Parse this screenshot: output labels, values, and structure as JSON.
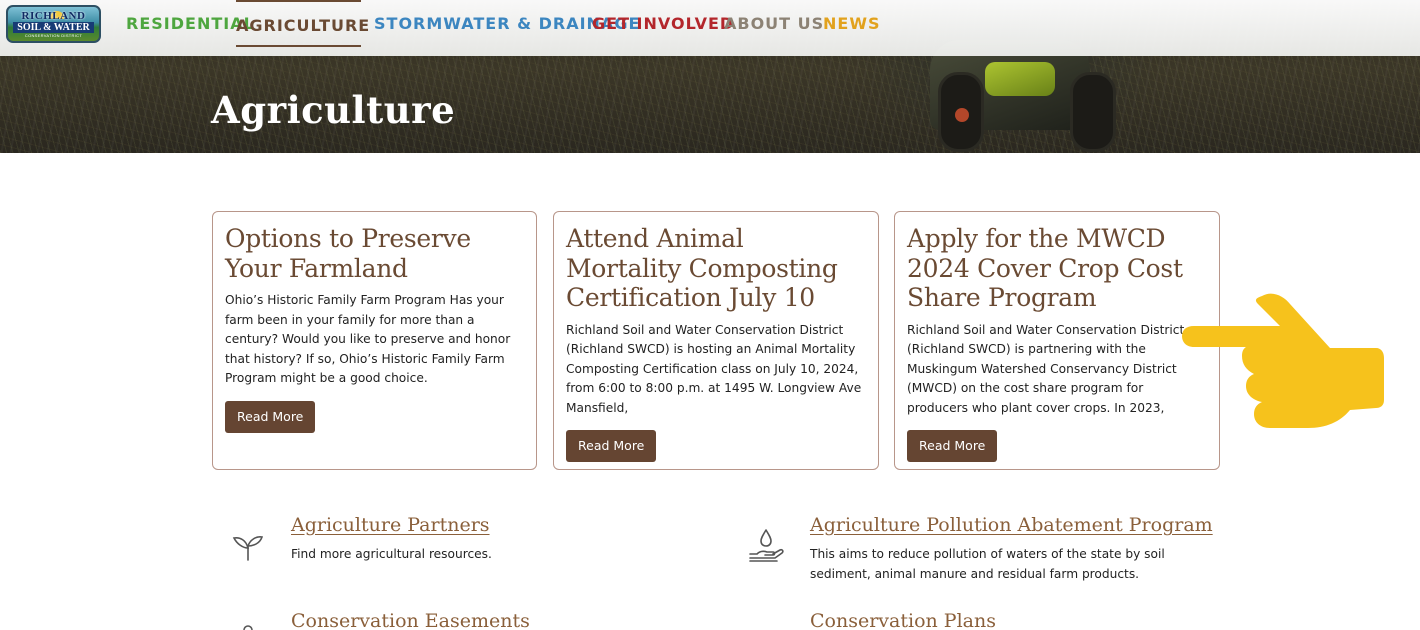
{
  "logo": {
    "line1": "RICHLAND",
    "line2": "SOIL & WATER",
    "line3": "CONSERVATION DISTRICT"
  },
  "nav": {
    "items": [
      {
        "label": "RESIDENTIAL",
        "color": "#4ea63f"
      },
      {
        "label": "AGRICULTURE",
        "color": "#6a4a33",
        "active": true
      },
      {
        "label": "STORMWATER & DRAINAGE",
        "color": "#3c86c0"
      },
      {
        "label": "GET INVOLVED",
        "color": "#b3262b"
      },
      {
        "label": "ABOUT US",
        "color": "#8c8274"
      },
      {
        "label": "NEWS",
        "color": "#e2a21d"
      }
    ]
  },
  "hero": {
    "title": "Agriculture"
  },
  "cards": [
    {
      "title": "Options to Preserve Your Farmland",
      "body": "Ohio’s Historic Family Farm Program Has your farm been in your family for more than a century? Would you like to preserve and honor that history? If so, Ohio’s Historic Family Farm Program might be a good choice.",
      "button": "Read More"
    },
    {
      "title": "Attend Animal Mortality Composting Certification July 10",
      "body": "Richland Soil and Water Conservation District (Richland SWCD) is hosting an Animal Mortality Composting Certification class on July 10, 2024, from 6:00 to 8:00 p.m. at 1495 W. Longview Ave Mansfield,",
      "button": "Read More"
    },
    {
      "title": "Apply for the MWCD 2024 Cover Crop Cost Share Program",
      "body": "Richland Soil and Water Conservation District (Richland SWCD) is partnering with the Muskingum Watershed Conservancy District (MWCD) on the cost share program for producers who plant cover crops. In 2023,",
      "button": "Read More"
    }
  ],
  "resources": [
    {
      "title": "Agriculture Partners",
      "desc": "Find more agricultural resources.",
      "icon": "sprout-icon"
    },
    {
      "title": "Agriculture Pollution Abatement Program",
      "desc": "This aims to reduce pollution of waters of the state by soil sediment, animal manure and residual farm products.",
      "icon": "water-drop-hand-icon"
    },
    {
      "title": "Conservation Easements",
      "desc": "",
      "icon": "easement-icon"
    },
    {
      "title": "Conservation Plans",
      "desc": "",
      "icon": "plan-icon"
    }
  ],
  "colors": {
    "brand_brown": "#6a4a33",
    "button_brown": "#654532",
    "card_border": "#b8968a",
    "pointer_yellow": "#f6c21c"
  }
}
